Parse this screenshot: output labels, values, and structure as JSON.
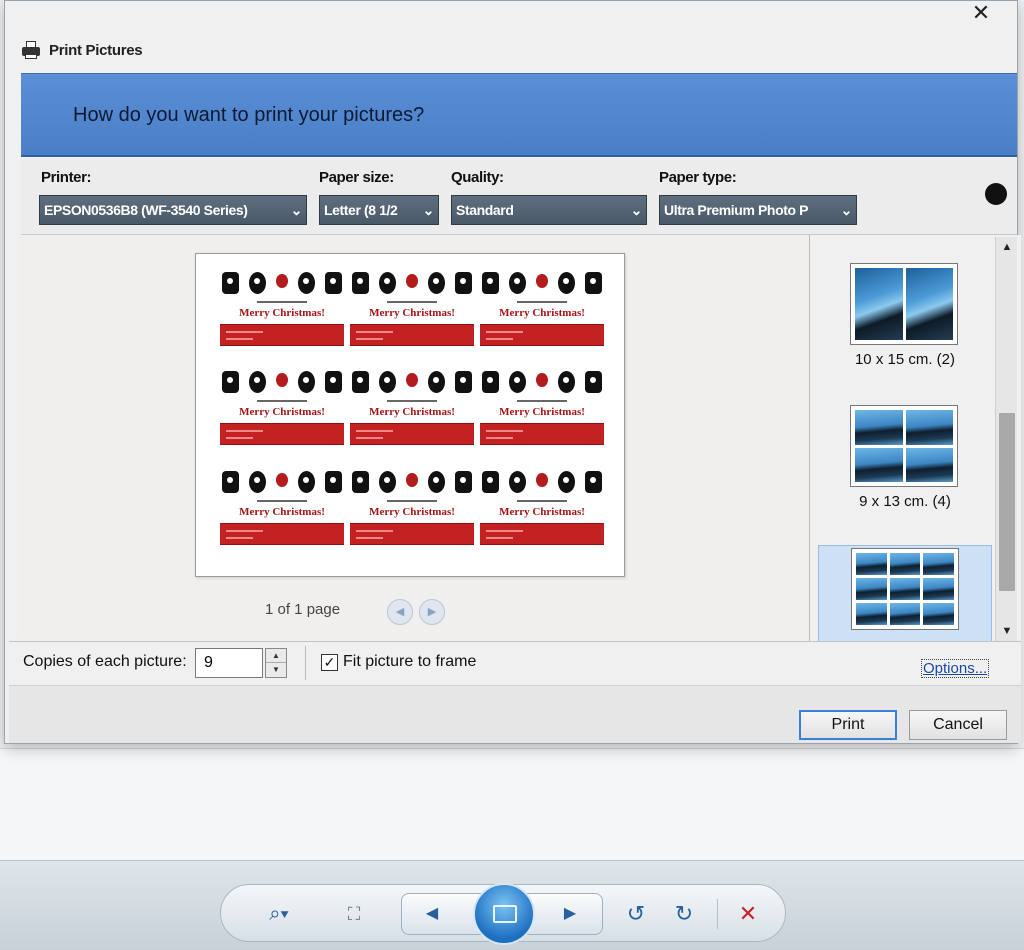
{
  "dialog": {
    "title": "Print Pictures",
    "banner": "How do you want to print your pictures?",
    "close_glyph": "✕"
  },
  "settings": {
    "printer": {
      "label": "Printer:",
      "value": "EPSON0536B8 (WF-3540 Series)"
    },
    "paper_size": {
      "label": "Paper size:",
      "value": "Letter (8 1/2"
    },
    "quality": {
      "label": "Quality:",
      "value": "Standard"
    },
    "paper_type": {
      "label": "Paper type:",
      "value": "Ultra Premium Photo P"
    }
  },
  "preview": {
    "tile_text": "Merry Christmas!",
    "tile_count": 9,
    "page_indicator": "1 of 1 page",
    "prev_glyph": "◀",
    "next_glyph": "▶"
  },
  "layouts": {
    "items": [
      {
        "label": "10 x 15 cm. (2)",
        "photos": 2,
        "selected": false
      },
      {
        "label": "9 x 13 cm. (4)",
        "photos": 4,
        "selected": false
      },
      {
        "label": "",
        "photos": 9,
        "selected": true
      }
    ],
    "scroll_up": "▲",
    "scroll_down": "▼"
  },
  "options": {
    "copies_label": "Copies of each picture:",
    "copies_value": "9",
    "spin_up": "▲",
    "spin_down": "▼",
    "fit_label": "Fit picture to frame",
    "fit_checked": true,
    "fit_check_glyph": "✓",
    "options_link": "Options..."
  },
  "buttons": {
    "print": "Print",
    "cancel": "Cancel"
  },
  "viewer_toolbar": {
    "zoom_glyph": "⌕▾",
    "fit_glyph": "⛶",
    "prev_glyph": "◀",
    "next_glyph": "▶",
    "rotate_ccw_glyph": "↺",
    "rotate_cw_glyph": "↻",
    "delete_glyph": "✕"
  },
  "colors": {
    "banner": "#4a7fc8",
    "select_bg": "#4a5968",
    "tile_red": "#c42222",
    "link": "#1848a8",
    "default_button_border": "#3c7fd8"
  }
}
